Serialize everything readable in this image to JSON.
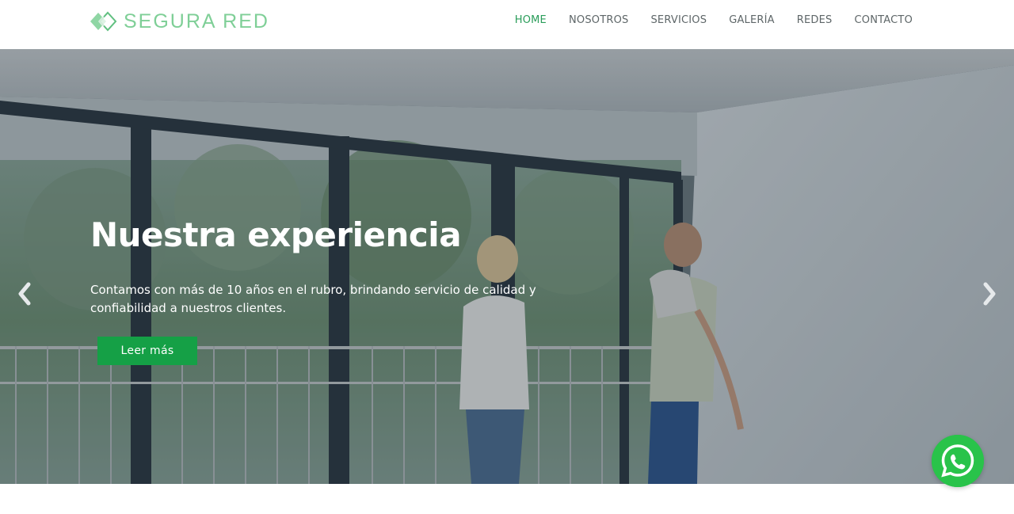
{
  "brand": {
    "name": "SEGURA RED",
    "logo_icon": "diamond-logo-icon",
    "color": "#7fcf97"
  },
  "nav": {
    "items": [
      {
        "label": "HOME",
        "active": true
      },
      {
        "label": "NOSOTROS",
        "active": false
      },
      {
        "label": "SERVICIOS",
        "active": false
      },
      {
        "label": "GALERÍA",
        "active": false
      },
      {
        "label": "REDES",
        "active": false
      },
      {
        "label": "CONTACTO",
        "active": false
      }
    ],
    "active_color": "#2a9d5a"
  },
  "hero": {
    "title": "Nuestra experiencia",
    "text": "Contamos con más de 10 años en el rubro, brindando servicio de calidad y confiabilidad a nuestros clientes.",
    "button_label": "Leer más",
    "button_color": "#15a046",
    "prev_icon": "chevron-left-icon",
    "next_icon": "chevron-right-icon"
  },
  "whatsapp": {
    "icon": "whatsapp-icon",
    "color": "#29c34a"
  }
}
